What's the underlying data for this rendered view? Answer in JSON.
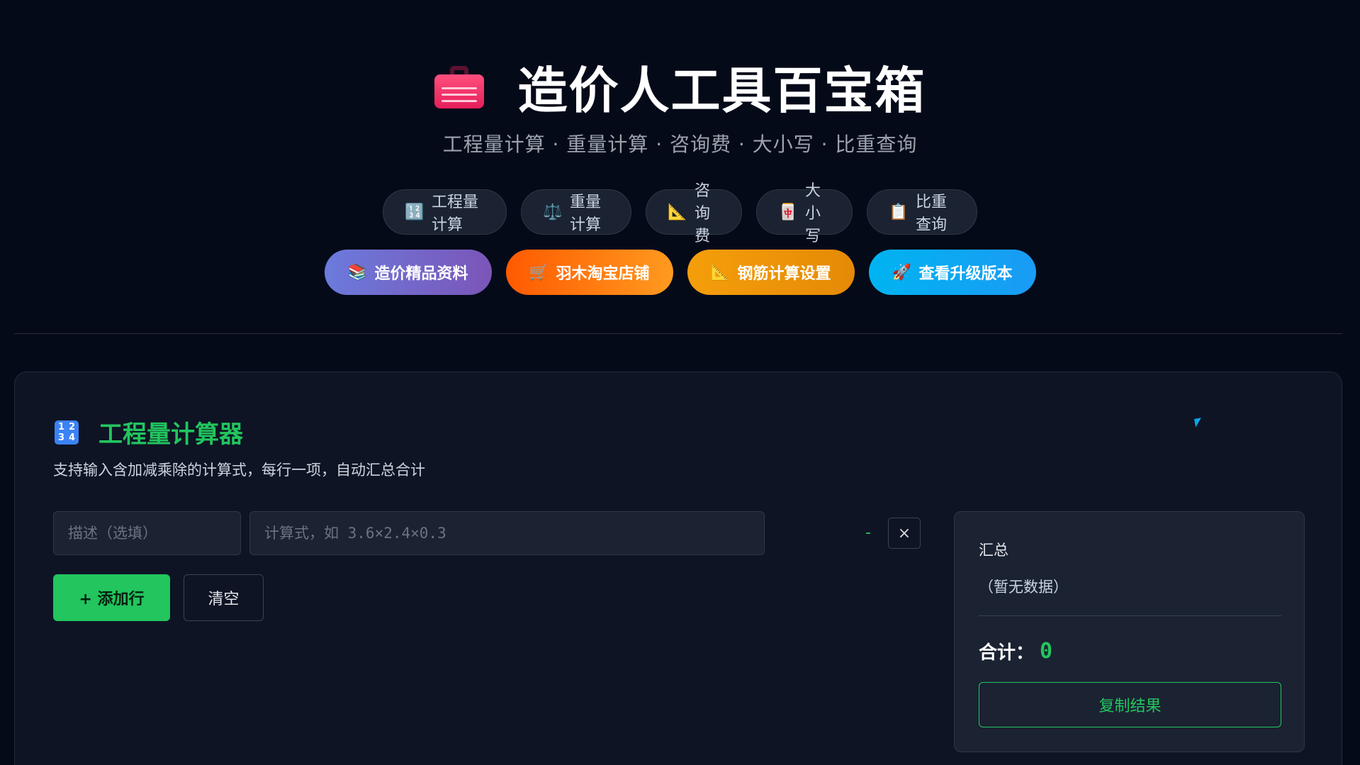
{
  "header": {
    "icon": "toolbox-icon",
    "title": "造价人工具百宝箱",
    "subtitle": "工程量计算 · 重量计算 · 咨询费 · 大小写 · 比重查询"
  },
  "tabs": [
    {
      "icon": "🔢",
      "label": "工程量计算"
    },
    {
      "icon": "⚖️",
      "label": "重量计算"
    },
    {
      "icon": "📐",
      "label": "咨询费"
    },
    {
      "icon": "🀄",
      "label": "大小写"
    },
    {
      "icon": "📋",
      "label": "比重查询"
    }
  ],
  "links": [
    {
      "icon": "📚",
      "label": "造价精品资料",
      "color": "#7468c9"
    },
    {
      "icon": "🛒",
      "label": "羽木淘宝店铺",
      "color": "#ff7a10"
    },
    {
      "icon": "📐",
      "label": "钢筋计算设置",
      "color": "#f59e0b"
    },
    {
      "icon": "🚀",
      "label": "查看升级版本",
      "color": "#0aa8f2"
    }
  ],
  "panel": {
    "title": "工程量计算器",
    "description": "支持输入含加减乘除的计算式，每行一项，自动汇总合计",
    "desc_placeholder": "描述（选填）",
    "formula_placeholder": "计算式，如 3.6×2.4×0.3",
    "row_result": "-",
    "delete_label": "×",
    "add_label": "+ 添加行",
    "clear_label": "清空"
  },
  "summary": {
    "title": "汇总",
    "empty_text": "（暂无数据）",
    "total_label": "合计：",
    "total_value": "0",
    "copy_label": "复制结果"
  },
  "colors": {
    "background": "#050a19",
    "accent": "#22c55e"
  }
}
